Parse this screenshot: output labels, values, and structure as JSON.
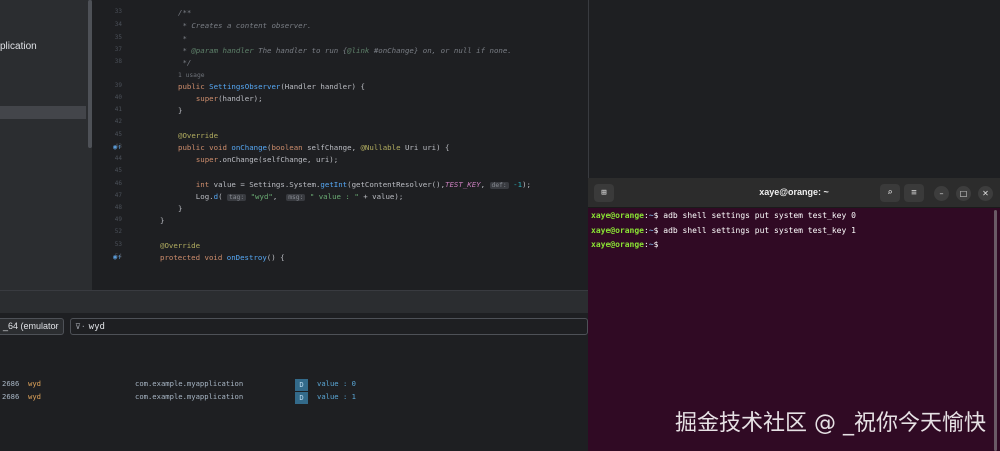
{
  "project_panel": {
    "partial_item": "plication"
  },
  "editor": {
    "lines": [
      {
        "n": "33",
        "html": "<span class='cm'>/**</span>"
      },
      {
        "n": "34",
        "html": "<span class='cm'> * Creates a content observer.</span>"
      },
      {
        "n": "35",
        "html": "<span class='cm'> *</span>"
      },
      {
        "n": "37",
        "html": "<span class='cm'> * </span><span class='cmtag'>@param</span><span class='cm'> </span><span class='cmtag'>handler</span><span class='cm'> The handler to run {</span><span class='cmtag'>@link</span><span class='cm'> #onChange} on, or null if none.</span>"
      },
      {
        "n": "38",
        "html": "<span class='cm'> */</span>"
      },
      {
        "n": "",
        "html": "<span class='usage'>1 usage</span>"
      },
      {
        "n": "39",
        "html": "<span class='kw'>public</span> <span class='fn'>SettingsObserver</span>(Handler handler) {"
      },
      {
        "n": "40",
        "html": "    <span class='kw'>super</span>(handler);"
      },
      {
        "n": "41",
        "html": "}"
      },
      {
        "n": "42",
        "html": ""
      },
      {
        "n": "45",
        "html": "<span class='ann'>@Override</span>"
      },
      {
        "n": "43",
        "html": "<span class='kw'>public void</span> <span class='fn'>onChange</span>(<span class='kw'>boolean</span> selfChange, <span class='ann'>@Nullable</span> Uri uri) {"
      },
      {
        "n": "44",
        "html": "    <span class='kw'>super</span>.onChange(selfChange, uri);"
      },
      {
        "n": "45",
        "html": ""
      },
      {
        "n": "46",
        "html": "    <span class='kw'>int</span> value = Settings.System.<span class='fn'>getInt</span>(getContentResolver(),<span class='const'>TEST_KEY</span>, <span class='hint'>def:</span> <span class='num'>-1</span>);"
      },
      {
        "n": "47",
        "html": "    Log.<span class='fn'>d</span>( <span class='hint'>tag:</span> <span class='str'>\"wyd\"</span>,  <span class='hint'>msg:</span> <span class='str'>\" value : \"</span> + value);"
      },
      {
        "n": "48",
        "html": "}"
      },
      {
        "n": "49",
        "html": "}"
      },
      {
        "n": "52",
        "html": ""
      },
      {
        "n": "53",
        "html": "<span class='ann'>@Override</span>"
      },
      {
        "n": "54",
        "html": "<span class='kw'>protected void</span> <span class='fn'>onDestroy</span>() {"
      }
    ]
  },
  "logcat": {
    "device_label": "_64 (emulator",
    "filter_value": "wyd",
    "rows": [
      {
        "pid": "2686",
        "tag": "wyd",
        "package": "com.example.myapplication",
        "level": "D",
        "message": "value : 0"
      },
      {
        "pid": "2686",
        "tag": "wyd",
        "package": "com.example.myapplication",
        "level": "D",
        "message": "value : 1"
      }
    ]
  },
  "terminal": {
    "title": "xaye@orange: ~",
    "lines": [
      {
        "user": "xaye@orange",
        "path": "~",
        "command": "adb shell settings put system test_key 0"
      },
      {
        "user": "xaye@orange",
        "path": "~",
        "command": "adb shell settings put system test_key 1"
      },
      {
        "user": "xaye@orange",
        "path": "~",
        "command": ""
      }
    ],
    "icons": {
      "new_tab": "new-tab-icon",
      "search": "search-icon",
      "menu": "hamburger-menu-icon",
      "minimize": "minimize-icon",
      "maximize": "maximize-icon",
      "close": "close-icon"
    }
  },
  "watermark": "掘金技术社区 @ _祝你今天愉快"
}
